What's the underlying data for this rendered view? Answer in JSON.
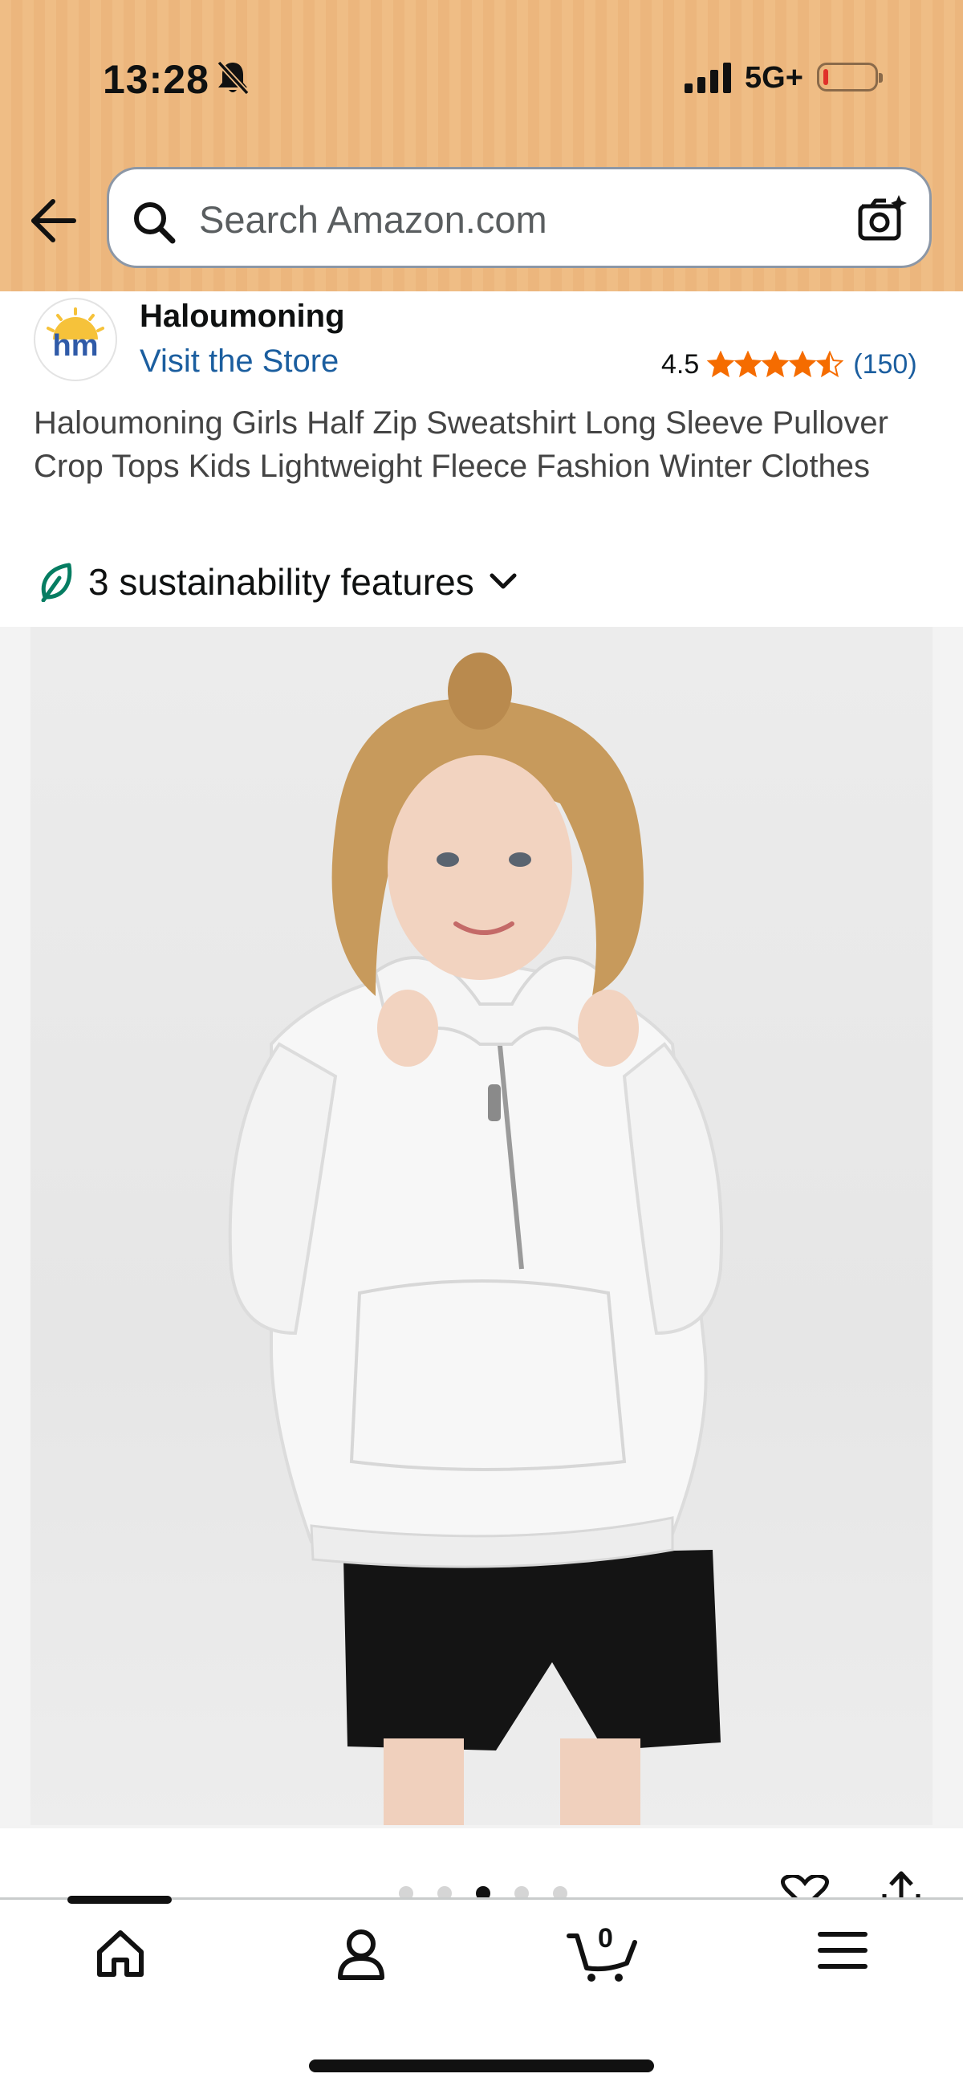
{
  "status_bar": {
    "time": "13:28",
    "network": "5G+",
    "icons": [
      "bell-off-icon",
      "signal-icon",
      "battery-icon"
    ]
  },
  "search": {
    "placeholder": "Search Amazon.com",
    "icons": [
      "back-arrow-icon",
      "search-icon",
      "camera-icon"
    ]
  },
  "store": {
    "brand": "Haloumoning",
    "logo_text": "hm",
    "visit_label": "Visit the Store",
    "rating": "4.5",
    "rating_value": 4.5,
    "rating_count": "(150)"
  },
  "product": {
    "title": "Haloumoning Girls Half Zip Sweatshirt Long Sleeve Pullover Crop Tops Kids Lightweight Fleece Fashion Winter Clothes",
    "sustainability": "3 sustainability features"
  },
  "gallery": {
    "image_count": 5,
    "active_index": 2
  },
  "bottom_nav": {
    "items": [
      "home-icon",
      "account-icon",
      "cart-icon",
      "menu-icon"
    ],
    "cart_count": "0"
  },
  "colors": {
    "header": "#efbd85",
    "link": "#1b5e9f",
    "star": "#f56c00",
    "leaf": "#067d62"
  }
}
